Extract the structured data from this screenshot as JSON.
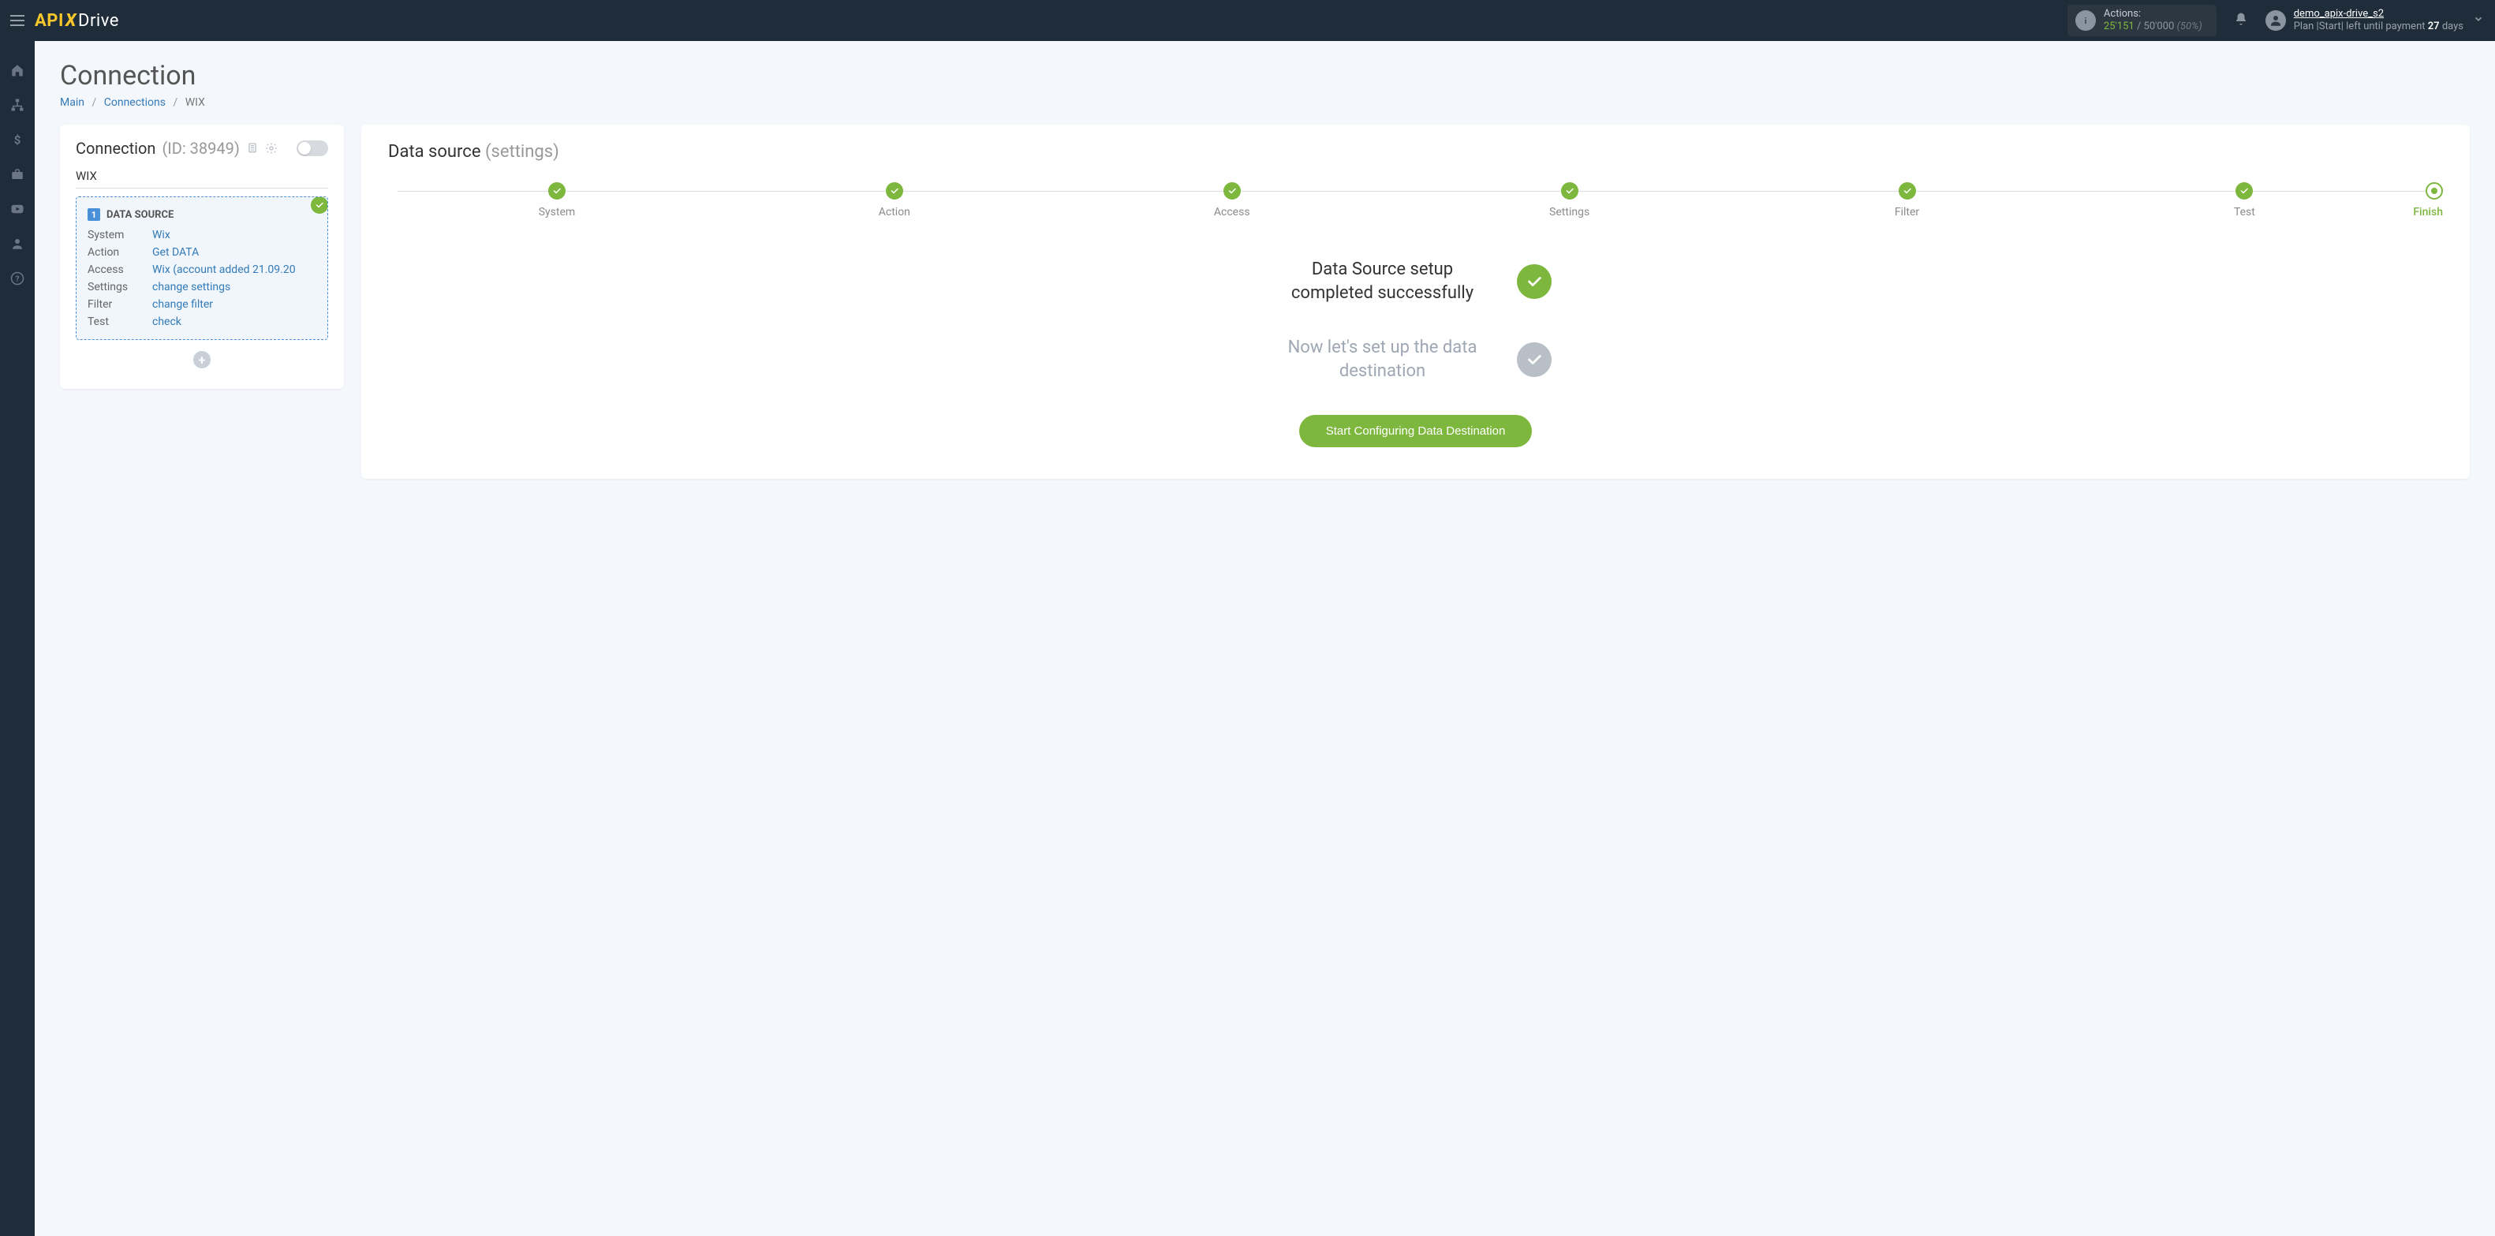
{
  "header": {
    "logo": {
      "api": "API",
      "x": "X",
      "drive": "Drive"
    },
    "actions": {
      "label": "Actions:",
      "used": "25'151",
      "total": "/ 50'000",
      "pct": "(50%)"
    },
    "account": {
      "name": "demo_apix-drive_s2",
      "plan_prefix": "Plan |Start| left until payment ",
      "days": "27",
      "days_suffix": " days"
    }
  },
  "page": {
    "title": "Connection",
    "breadcrumb": {
      "main": "Main",
      "connections": "Connections",
      "current": "WIX"
    }
  },
  "conn_card": {
    "title": "Connection",
    "id_label": "(ID: 38949)",
    "name": "WIX",
    "ds_box": {
      "badge": "1",
      "heading": "DATA SOURCE",
      "rows": {
        "system": {
          "label": "System",
          "value": "Wix"
        },
        "action": {
          "label": "Action",
          "value": "Get DATA"
        },
        "access": {
          "label": "Access",
          "value": "Wix (account added 21.09.20"
        },
        "settings": {
          "label": "Settings",
          "value": "change settings"
        },
        "filter": {
          "label": "Filter",
          "value": "change filter"
        },
        "test": {
          "label": "Test",
          "value": "check"
        }
      }
    }
  },
  "main_card": {
    "title": "Data source",
    "subtitle": "(settings)",
    "steps": {
      "system": "System",
      "action": "Action",
      "access": "Access",
      "settings": "Settings",
      "filter": "Filter",
      "test": "Test",
      "finish": "Finish"
    },
    "status_done": "Data Source setup completed successfully",
    "status_pending": "Now let's set up the data destination",
    "cta": "Start Configuring Data Destination"
  }
}
